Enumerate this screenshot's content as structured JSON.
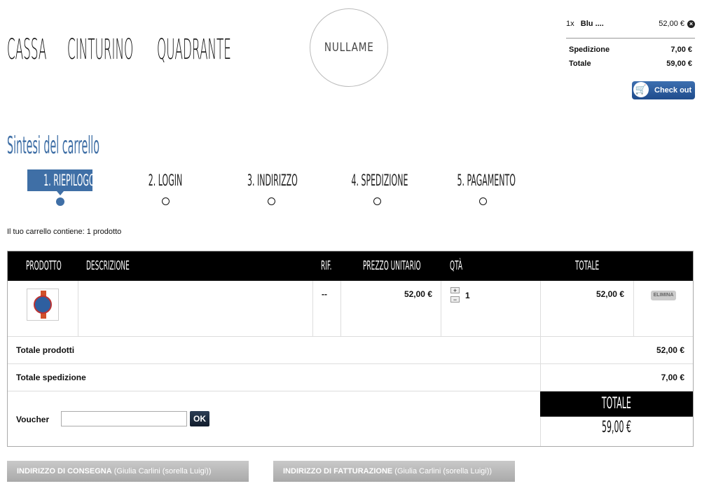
{
  "nav": {
    "items": [
      "CASSA",
      "CINTURINO",
      "QUADRANTE"
    ]
  },
  "logo": {
    "text": "NULLAME"
  },
  "mini_cart": {
    "item_qty": "1x",
    "item_name": "Blu ....",
    "item_price": "52,00 €",
    "shipping_label": "Spedizione",
    "shipping_value": "7,00 €",
    "total_label": "Totale",
    "total_value": "59,00 €",
    "checkout_label": "Check out"
  },
  "page_title": "Sintesi del carrello",
  "steps": [
    "1. RIEPILOGO",
    "2. LOGIN",
    "3. INDIRIZZO",
    "4. SPEDIZIONE",
    "5. PAGAMENTO"
  ],
  "active_step": 0,
  "summary": "Il tuo carrello contiene: 1 prodotto",
  "table": {
    "headers": [
      "PRODOTTO",
      "DESCRIZIONE",
      "RIF.",
      "PREZZO UNITARIO",
      "QTÀ",
      "TOTALE"
    ],
    "row": {
      "description": "",
      "ref": "--",
      "unit_price": "52,00 €",
      "qty": "1",
      "total": "52,00 €",
      "remove": "ELIMINA"
    },
    "qty_plus": "+",
    "qty_minus": "−",
    "total_products_label": "Totale prodotti",
    "total_products_value": "52,00 €",
    "total_shipping_label": "Totale spedizione",
    "total_shipping_value": "7,00 €",
    "voucher_label": "Voucher",
    "voucher_value": "",
    "ok_label": "OK",
    "grand_total_label": "TOTALE",
    "grand_total_value": "59,00 €"
  },
  "addresses": {
    "delivery_label": "INDIRIZZO DI CONSEGNA",
    "delivery_name": " (Giulia Carlini (sorella Luigi))",
    "billing_label": "INDIRIZZO DI FATTURAZIONE",
    "billing_name": " (Giulia Carlini (sorella Luigi))"
  },
  "colors": {
    "accent": "#3f6fa6",
    "header_bg": "#000000",
    "checkout_bg": "#2b5b9c"
  }
}
